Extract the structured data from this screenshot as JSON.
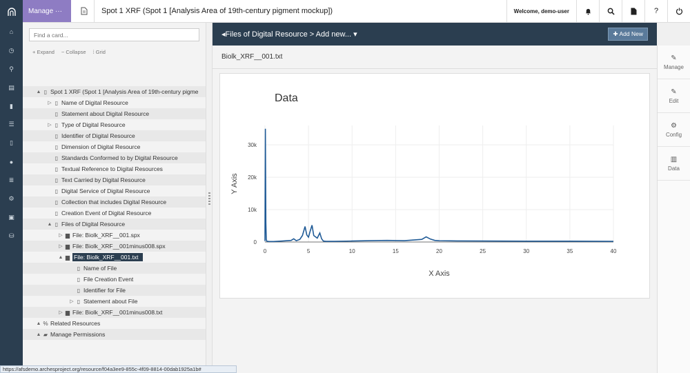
{
  "header": {
    "manage_label": "Manage ···",
    "title": "Spot 1 XRF (Spot 1 [Analysis Area of 19th-century pigment mockup])",
    "welcome": "Welcome, demo-user",
    "icons": [
      "bell-icon",
      "search-icon",
      "document-icon",
      "help-icon",
      "logout-icon"
    ]
  },
  "nav_icons": [
    "home-icon",
    "clock-icon",
    "search-icon",
    "book-icon",
    "bookmark-icon",
    "list-icon",
    "mobile-icon",
    "user-icon",
    "layers-icon",
    "gear-icon",
    "image-icon",
    "database-icon"
  ],
  "tree_panel": {
    "search_placeholder": "Find a card...",
    "expand": "Expand",
    "collapse": "Collapse",
    "grid": "Grid",
    "nodes": [
      {
        "label": "Spot 1 XRF (Spot 1 [Analysis Area of 19th-century pigme",
        "depth": 0,
        "toggle": "▲",
        "icon": "doc"
      },
      {
        "label": "Name of Digital Resource",
        "depth": 1,
        "toggle": "▷",
        "icon": "doc"
      },
      {
        "label": "Statement about Digital Resource",
        "depth": 1,
        "toggle": "",
        "icon": "doc"
      },
      {
        "label": "Type of Digital Resource",
        "depth": 1,
        "toggle": "▷",
        "icon": "doc"
      },
      {
        "label": "Identifier of Digital Resource",
        "depth": 1,
        "toggle": "",
        "icon": "doc"
      },
      {
        "label": "Dimension of Digital Resource",
        "depth": 1,
        "toggle": "",
        "icon": "doc"
      },
      {
        "label": "Standards Conformed to by Digital Resource",
        "depth": 1,
        "toggle": "",
        "icon": "doc"
      },
      {
        "label": "Textual Reference to Digital Resources",
        "depth": 1,
        "toggle": "",
        "icon": "doc"
      },
      {
        "label": "Text Carried by Digital Resource",
        "depth": 1,
        "toggle": "",
        "icon": "doc"
      },
      {
        "label": "Digital Service of Digital Resource",
        "depth": 1,
        "toggle": "",
        "icon": "doc"
      },
      {
        "label": "Collection that includes Digital Resource",
        "depth": 1,
        "toggle": "",
        "icon": "doc"
      },
      {
        "label": "Creation Event of Digital Resource",
        "depth": 1,
        "toggle": "",
        "icon": "doc"
      },
      {
        "label": "Files of Digital Resource",
        "depth": 1,
        "toggle": "▲",
        "icon": "doc"
      },
      {
        "label": "File: Biolk_XRF__001.spx",
        "depth": 2,
        "toggle": "▷",
        "icon": "file"
      },
      {
        "label": "File: Biolk_XRF__001minus008.spx",
        "depth": 2,
        "toggle": "▷",
        "icon": "file"
      },
      {
        "label": "File: Biolk_XRF__001.txt",
        "depth": 2,
        "toggle": "▲",
        "icon": "file",
        "selected": true
      },
      {
        "label": "Name of File",
        "depth": 3,
        "toggle": "",
        "icon": "doc"
      },
      {
        "label": "File Creation Event",
        "depth": 3,
        "toggle": "",
        "icon": "doc"
      },
      {
        "label": "Identifier for File",
        "depth": 3,
        "toggle": "",
        "icon": "doc"
      },
      {
        "label": "Statement about File",
        "depth": 3,
        "toggle": "▷",
        "icon": "doc"
      },
      {
        "label": "File: Biolk_XRF__001minus008.txt",
        "depth": 2,
        "toggle": "▷",
        "icon": "file"
      },
      {
        "label": "Related Resources",
        "depth": 0,
        "toggle": "▲",
        "icon": "link"
      },
      {
        "label": "Manage Permissions",
        "depth": 0,
        "toggle": "▲",
        "icon": "lock"
      }
    ]
  },
  "main": {
    "breadcrumb": "Files of Digital Resource > Add new...",
    "add_new": "Add New",
    "file_name": "Biolk_XRF__001.txt"
  },
  "right_rail": [
    {
      "label": "Manage",
      "icon": "pencil-icon"
    },
    {
      "label": "Edit",
      "icon": "pencil-icon"
    },
    {
      "label": "Config",
      "icon": "gear-icon"
    },
    {
      "label": "Data",
      "icon": "bar-chart-icon"
    }
  ],
  "status_url": "https://afsdemo.archesproject.org/resource/f04a3ee9-855c-4f09-8814-00dab1925a1b#",
  "chart_data": {
    "type": "line",
    "title": "Data",
    "xlabel": "X Axis",
    "ylabel": "Y Axis",
    "xlim": [
      0,
      40
    ],
    "ylim": [
      0,
      36000
    ],
    "xticks": [
      0,
      5,
      10,
      15,
      20,
      25,
      30,
      35,
      40
    ],
    "yticks": [
      0,
      10000,
      20000,
      30000
    ],
    "ytick_labels": [
      "0",
      "10k",
      "20k",
      "30k"
    ],
    "grid": true,
    "color": "#1f5a96",
    "x": [
      0,
      0.05,
      0.1,
      0.15,
      0.2,
      0.3,
      0.5,
      1,
      2,
      3,
      3.3,
      3.6,
      4,
      4.3,
      4.6,
      4.8,
      5,
      5.2,
      5.4,
      5.6,
      6,
      6.3,
      6.5,
      6.7,
      7,
      8,
      10,
      12,
      14,
      16,
      18,
      18.5,
      19,
      19.5,
      20,
      22,
      25,
      30,
      35,
      40
    ],
    "y": [
      300,
      35000,
      6000,
      800,
      300,
      200,
      150,
      150,
      300,
      500,
      1000,
      400,
      800,
      2000,
      4800,
      2200,
      1500,
      3500,
      5200,
      2000,
      1200,
      2800,
      1000,
      300,
      200,
      200,
      300,
      400,
      500,
      400,
      800,
      1600,
      900,
      500,
      400,
      350,
      300,
      250,
      250,
      200
    ]
  }
}
